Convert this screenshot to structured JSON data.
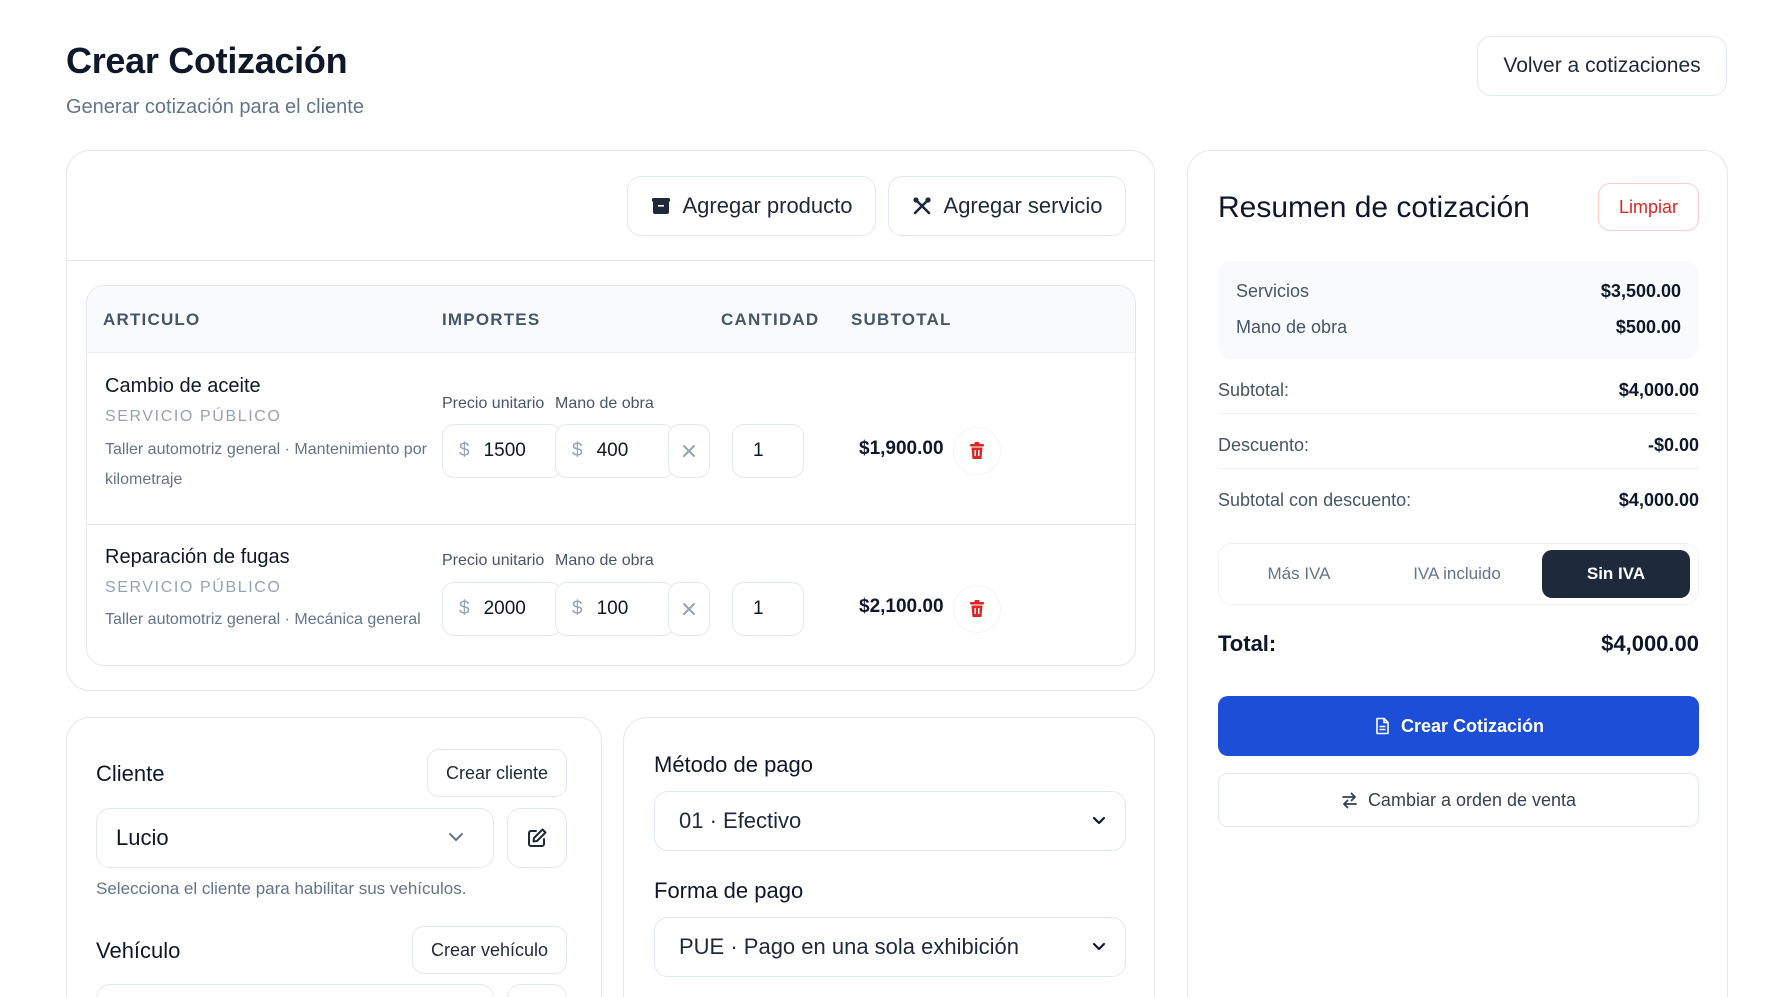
{
  "header": {
    "title": "Crear Cotización",
    "subtitle": "Generar cotización para el cliente",
    "back_label": "Volver a cotizaciones"
  },
  "items": {
    "add_product_label": "Agregar producto",
    "add_service_label": "Agregar servicio",
    "columns": [
      "ARTICULO",
      "IMPORTES",
      "CANTIDAD",
      "SUBTOTAL"
    ],
    "unit_price_label": "Precio unitario",
    "labor_label": "Mano de obra",
    "currency_symbol": "$",
    "rows": [
      {
        "name": "Cambio de aceite",
        "type": "SERVICIO PÚBLICO",
        "description": "Taller automotriz general · Mantenimiento por kilometraje",
        "unit_price": "1500",
        "labor": "400",
        "quantity": "1",
        "subtotal": "$1,900.00"
      },
      {
        "name": "Reparación de fugas",
        "type": "SERVICIO PÚBLICO",
        "description": "Taller automotriz general · Mecánica general",
        "unit_price": "2000",
        "labor": "100",
        "quantity": "1",
        "subtotal": "$2,100.00"
      }
    ]
  },
  "client": {
    "title": "Cliente",
    "create_label": "Crear cliente",
    "selected": "Lucio",
    "hint": "Selecciona el cliente para habilitar sus vehículos."
  },
  "vehicle": {
    "title": "Vehículo",
    "create_label": "Crear vehículo"
  },
  "payment": {
    "method_title": "Método de pago",
    "method_value": "01 · Efectivo",
    "form_title": "Forma de pago",
    "form_value": "PUE · Pago en una sola exhibición"
  },
  "summary": {
    "title": "Resumen de cotización",
    "clear_label": "Limpiar",
    "services_label": "Servicios",
    "services_value": "$3,500.00",
    "labor_label": "Mano de obra",
    "labor_value": "$500.00",
    "subtotal_label": "Subtotal:",
    "subtotal_value": "$4,000.00",
    "discount_label": "Descuento:",
    "discount_value": "-$0.00",
    "subtotal_discount_label": "Subtotal con descuento:",
    "subtotal_discount_value": "$4,000.00",
    "iva_options": [
      "Más IVA",
      "IVA incluido",
      "Sin IVA"
    ],
    "iva_selected": "Sin IVA",
    "total_label": "Total:",
    "total_value": "$4,000.00",
    "create_label": "Crear Cotización",
    "switch_label": "Cambiar a orden de venta"
  },
  "colors": {
    "primary": "#1d4ed8",
    "danger": "#dc2626",
    "dark": "#1e293b",
    "muted": "#64748b"
  }
}
